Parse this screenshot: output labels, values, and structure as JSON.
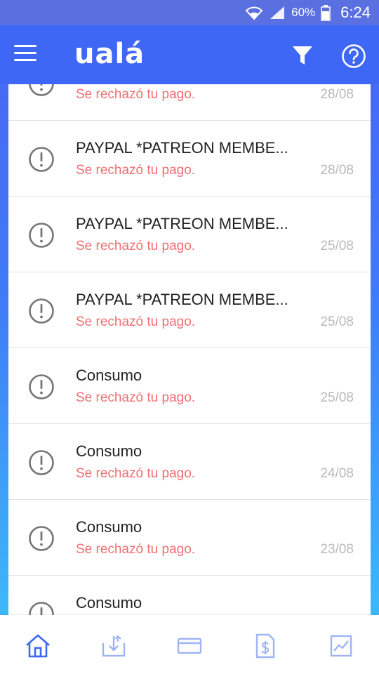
{
  "status_bar": {
    "battery_percent": "60%",
    "time": "6:24",
    "icons": [
      "wifi-icon",
      "signal-icon",
      "battery-icon"
    ]
  },
  "header": {
    "logo": "ualá",
    "icons": [
      "menu-icon",
      "filter-icon",
      "help-icon"
    ]
  },
  "transactions": [
    {
      "merchant": "",
      "status": "Se rechazó tu pago.",
      "date": "28/08"
    },
    {
      "merchant": "PAYPAL *PATREON MEMBE...",
      "status": "Se rechazó tu pago.",
      "date": "28/08"
    },
    {
      "merchant": "PAYPAL *PATREON MEMBE...",
      "status": "Se rechazó tu pago.",
      "date": "25/08"
    },
    {
      "merchant": "PAYPAL *PATREON MEMBE...",
      "status": "Se rechazó tu pago.",
      "date": "25/08"
    },
    {
      "merchant": "Consumo",
      "status": "Se rechazó tu pago.",
      "date": "25/08"
    },
    {
      "merchant": "Consumo",
      "status": "Se rechazó tu pago.",
      "date": "24/08"
    },
    {
      "merchant": "Consumo",
      "status": "Se rechazó tu pago.",
      "date": "23/08"
    },
    {
      "merchant": "Consumo",
      "status": "",
      "date": ""
    }
  ],
  "bottom_nav": {
    "active": "home",
    "items": [
      "home-icon",
      "transfer-icon",
      "card-icon",
      "invoice-icon",
      "investments-icon"
    ]
  },
  "colors": {
    "header": "#3e67f5",
    "rejected_text": "#f06f72",
    "date_text": "#b9b9b9",
    "nav_active": "#3e67f5",
    "nav_inactive": "#9fb4f7"
  }
}
